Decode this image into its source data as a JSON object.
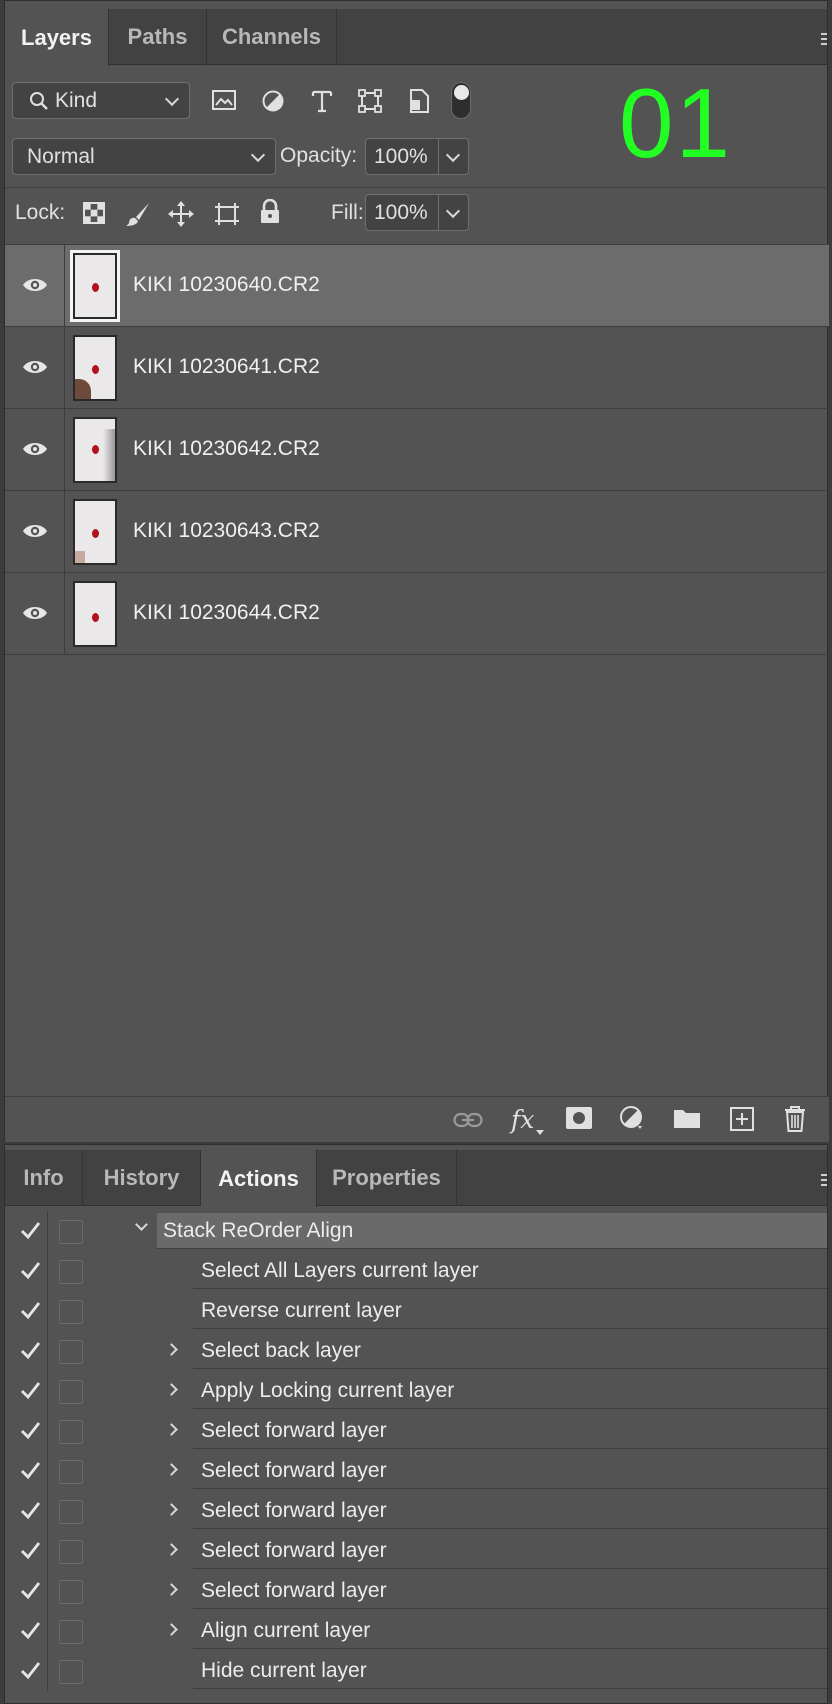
{
  "layers_panel": {
    "tabs": [
      "Layers",
      "Paths",
      "Channels"
    ],
    "active_tab": "Layers",
    "filter": {
      "label": "Kind"
    },
    "blend_mode": "Normal",
    "opacity_label": "Opacity:",
    "opacity_value": "100%",
    "lock_label": "Lock:",
    "fill_label": "Fill:",
    "fill_value": "100%",
    "overlay_number": "01",
    "layers": [
      {
        "name": "KIKI 10230640.CR2",
        "visible": true,
        "selected": true
      },
      {
        "name": "KIKI 10230641.CR2",
        "visible": true,
        "selected": false
      },
      {
        "name": "KIKI 10230642.CR2",
        "visible": true,
        "selected": false
      },
      {
        "name": "KIKI 10230643.CR2",
        "visible": true,
        "selected": false
      },
      {
        "name": "KIKI 10230644.CR2",
        "visible": true,
        "selected": false
      }
    ],
    "footer_icons": [
      "link-icon",
      "fx-icon",
      "mask-icon",
      "adjustment-icon",
      "folder-icon",
      "new-layer-icon",
      "trash-icon"
    ]
  },
  "actions_panel": {
    "tabs": [
      "Info",
      "History",
      "Actions",
      "Properties"
    ],
    "active_tab": "Actions",
    "actions": [
      {
        "label": "Stack ReOrder Align",
        "expandable": true,
        "expanded": true,
        "level": 0
      },
      {
        "label": "Select All Layers current layer",
        "expandable": false,
        "level": 1
      },
      {
        "label": "Reverse current layer",
        "expandable": false,
        "level": 1
      },
      {
        "label": "Select back layer",
        "expandable": true,
        "level": 1
      },
      {
        "label": "Apply Locking current layer",
        "expandable": true,
        "level": 1
      },
      {
        "label": "Select forward layer",
        "expandable": true,
        "level": 1
      },
      {
        "label": "Select forward layer",
        "expandable": true,
        "level": 1
      },
      {
        "label": "Select forward layer",
        "expandable": true,
        "level": 1
      },
      {
        "label": "Select forward layer",
        "expandable": true,
        "level": 1
      },
      {
        "label": "Select forward layer",
        "expandable": true,
        "level": 1
      },
      {
        "label": "Align current layer",
        "expandable": true,
        "level": 1
      },
      {
        "label": "Hide current layer",
        "expandable": false,
        "level": 1
      }
    ]
  },
  "colors": {
    "panel_bg": "#535353",
    "selected_row": "#6c6c6c",
    "overlay_green": "#22ff22"
  }
}
